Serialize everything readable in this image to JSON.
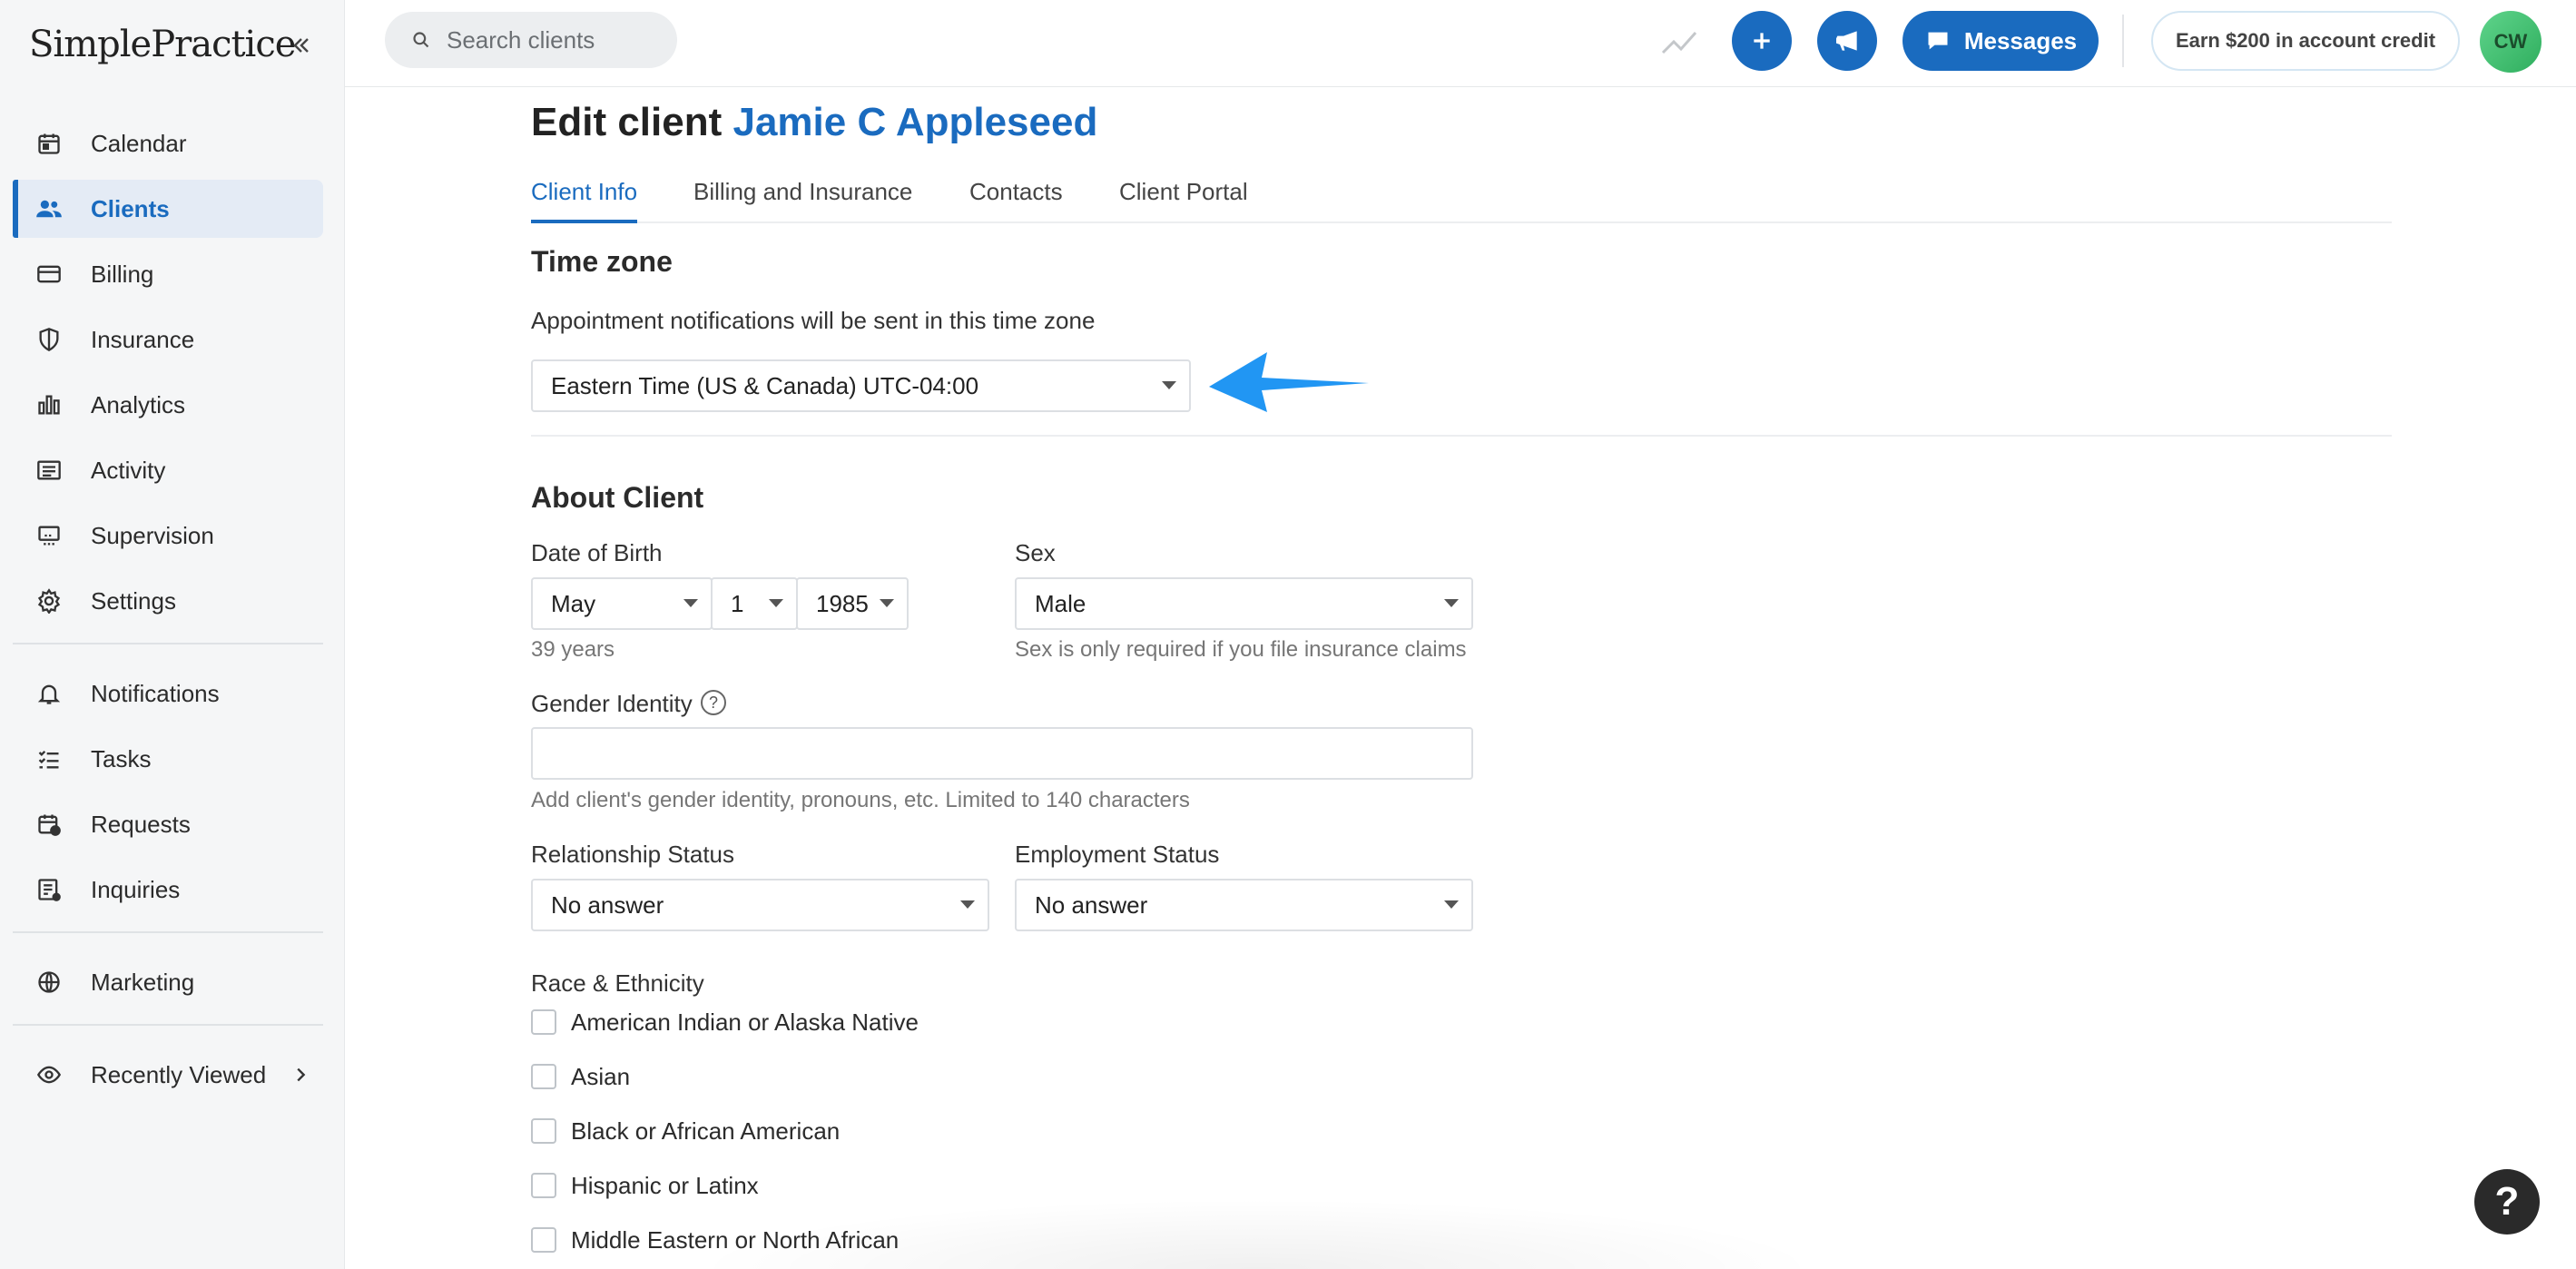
{
  "app": {
    "logo": "SimplePractice"
  },
  "sidebar": {
    "items": [
      {
        "label": "Calendar",
        "icon": "calendar-icon"
      },
      {
        "label": "Clients",
        "icon": "users-icon",
        "active": true
      },
      {
        "label": "Billing",
        "icon": "credit-card-icon"
      },
      {
        "label": "Insurance",
        "icon": "shield-icon"
      },
      {
        "label": "Analytics",
        "icon": "bar-chart-icon"
      },
      {
        "label": "Activity",
        "icon": "list-icon"
      },
      {
        "label": "Supervision",
        "icon": "supervision-icon"
      },
      {
        "label": "Settings",
        "icon": "gear-icon"
      }
    ],
    "secondary": [
      {
        "label": "Notifications",
        "icon": "bell-icon"
      },
      {
        "label": "Tasks",
        "icon": "checklist-icon"
      },
      {
        "label": "Requests",
        "icon": "calendar-request-icon"
      },
      {
        "label": "Inquiries",
        "icon": "inquiry-icon"
      }
    ],
    "marketing": {
      "label": "Marketing",
      "icon": "globe-icon"
    },
    "recent": {
      "label": "Recently Viewed",
      "icon": "eye-icon"
    }
  },
  "topbar": {
    "search_placeholder": "Search clients",
    "messages_label": "Messages",
    "earn_label": "Earn $200 in account credit",
    "avatar_initials": "CW"
  },
  "page": {
    "title_prefix": "Edit client",
    "client_name": "Jamie C Appleseed",
    "tabs": [
      "Client Info",
      "Billing and Insurance",
      "Contacts",
      "Client Portal"
    ],
    "active_tab": "Client Info"
  },
  "timezone": {
    "heading": "Time zone",
    "description": "Appointment notifications will be sent in this time zone",
    "value": "Eastern Time (US & Canada) UTC-04:00"
  },
  "about": {
    "heading": "About Client",
    "dob_label": "Date of Birth",
    "dob_month": "May",
    "dob_day": "1",
    "dob_year": "1985",
    "age": "39 years",
    "sex_label": "Sex",
    "sex_value": "Male",
    "sex_help": "Sex is only required if you file insurance claims",
    "gender_label": "Gender Identity",
    "gender_value": "",
    "gender_help": "Add client's gender identity, pronouns, etc. Limited to 140 characters",
    "relationship_label": "Relationship Status",
    "relationship_value": "No answer",
    "employment_label": "Employment Status",
    "employment_value": "No answer",
    "race_label": "Race & Ethnicity",
    "race_options": [
      "American Indian or Alaska Native",
      "Asian",
      "Black or African American",
      "Hispanic or Latinx",
      "Middle Eastern or North African"
    ]
  },
  "colors": {
    "brand": "#1a6bbf",
    "arrow": "#2196f3"
  }
}
